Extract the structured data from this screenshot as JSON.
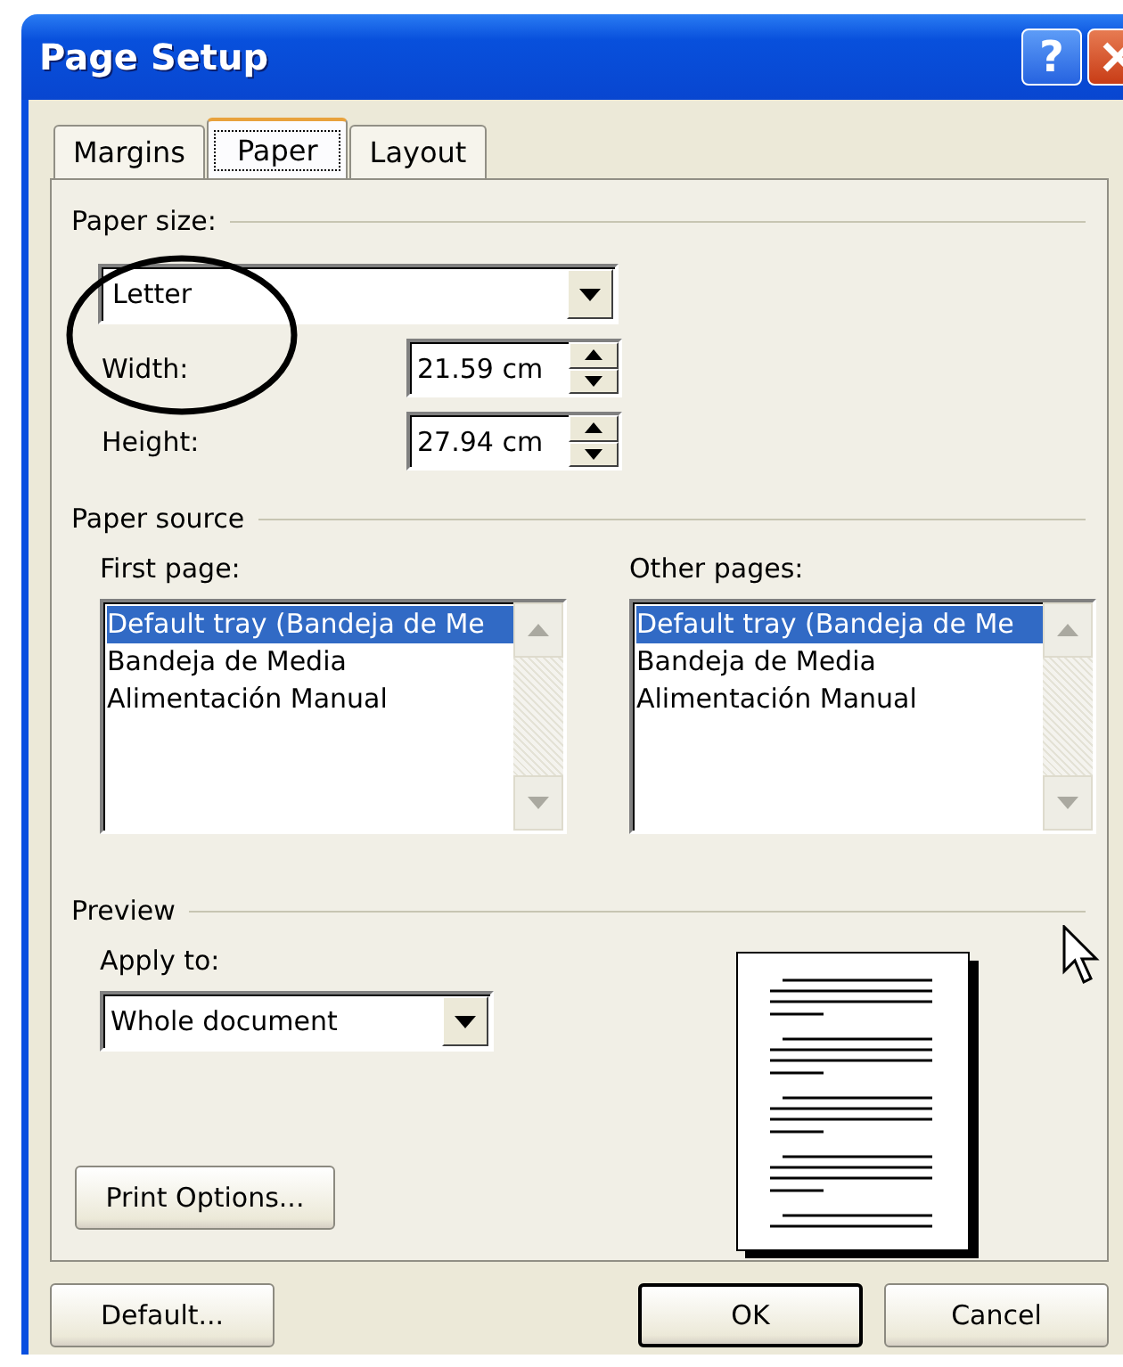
{
  "window": {
    "title": "Page Setup",
    "help": "?"
  },
  "tabs": [
    {
      "label": "Margins",
      "selected": false
    },
    {
      "label": "Paper",
      "selected": true
    },
    {
      "label": "Layout",
      "selected": false
    }
  ],
  "paper_size": {
    "label": "Paper size:",
    "value": "Letter",
    "width": {
      "label": "Width:",
      "value": "21.59 cm"
    },
    "height": {
      "label": "Height:",
      "value": "27.94 cm"
    }
  },
  "paper_source": {
    "label": "Paper source",
    "lists": [
      {
        "label": "First page:",
        "items": [
          {
            "text": "Default tray (Bandeja de Me",
            "selected": true
          },
          {
            "text": "Bandeja de Media",
            "selected": false
          },
          {
            "text": "Alimentación Manual",
            "selected": false
          }
        ]
      },
      {
        "label": "Other pages:",
        "items": [
          {
            "text": "Default tray (Bandeja de Me",
            "selected": true
          },
          {
            "text": "Bandeja de Media",
            "selected": false
          },
          {
            "text": "Alimentación Manual",
            "selected": false
          }
        ]
      }
    ]
  },
  "preview": {
    "label": "Preview",
    "apply_to": {
      "label": "Apply to:",
      "value": "Whole document"
    },
    "print_options": "Print Options..."
  },
  "buttons": [
    {
      "label": "Default...",
      "default": false
    },
    {
      "label": "OK",
      "default": true
    },
    {
      "label": "Cancel",
      "default": false
    }
  ]
}
